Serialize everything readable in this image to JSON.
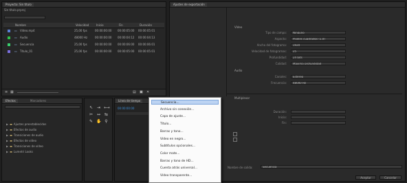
{
  "project": {
    "tab": "Proyecto: Sin título",
    "info_text": "Sin título.prproj",
    "columns": [
      "Nombre",
      "Velocidad",
      "Inicio",
      "Fin",
      "Duración"
    ],
    "items": [
      {
        "name": "Vídeo.mp4",
        "cells": [
          "25,00 fps",
          "00:00:00:00",
          "00:00:05:00",
          "00:00:05:01"
        ],
        "color": "#5a7fd6"
      },
      {
        "name": "Audio",
        "cells": [
          "48000 Hz",
          "00:00:00:00",
          "00:00:04:12",
          "00:00:04:13"
        ],
        "color": "#2fbf4a"
      },
      {
        "name": "Secuencia",
        "cells": [
          "25,00 fps",
          "00:00:00:00",
          "00:00:06:00",
          "00:00:06:01"
        ],
        "color": "#39d06e"
      },
      {
        "name": "Título_01",
        "cells": [
          "25,00 fps",
          "00:00:00:00",
          "00:00:05:00",
          "00:00:05:01"
        ],
        "color": "#7a70e0"
      }
    ]
  },
  "settings": {
    "tab": "Ajustes de exportación",
    "sections": [
      "Vídeo",
      "Audio",
      "Multiplexor"
    ],
    "video_fields": [
      {
        "label": "Tipo de campo:",
        "value": "Ninguno"
      },
      {
        "label": "Aspecto:",
        "value": "Píxeles cuadrados (1,0)"
      },
      {
        "label": "Ancho del fotograma:",
        "value": "1920"
      },
      {
        "label": "Velocidad de fotogramas:",
        "value": "25"
      },
      {
        "label": "Profundidad:",
        "value": "24 bits"
      },
      {
        "label": "Calidad:",
        "value": "Máxima profundidad"
      }
    ],
    "audio_fields": [
      {
        "label": "Canales:",
        "value": "Estéreo"
      },
      {
        "label": "Frecuencia:",
        "value": "48000 Hz"
      }
    ],
    "mux_fields": [
      {
        "label": "Duración:",
        "value": ""
      },
      {
        "label": "Inicio:",
        "value": ""
      },
      {
        "label": "Fin:",
        "value": ""
      }
    ],
    "name_label": "Nombre de salida:",
    "name_value": "Secuencia",
    "ok": "Aceptar",
    "cancel": "Cancelar"
  },
  "effects": {
    "tab": "Efectos",
    "tab2": "Marcadores",
    "search_placeholder": "",
    "tree": [
      "Ajustes preestablecidos",
      "Efectos de audio",
      "Transiciones de audio",
      "Efectos de vídeo",
      "Transiciones de vídeo",
      "Lumetri Looks"
    ]
  },
  "timeline": {
    "tab": "Línea de tiempo",
    "timecode": "00:00:00:00"
  },
  "context_menu": {
    "items": [
      "Secuencia...",
      "Archivo sin conexión...",
      "Capa de ajuste...",
      "Título...",
      "Barras y tono...",
      "Vídeo en negro...",
      "Subtítulos opcionales...",
      "Color mate...",
      "Barras y tono de HD...",
      "Cuenta atrás universal...",
      "Vídeo transparente..."
    ],
    "selected_index": 0
  },
  "colors": {
    "menu_highlight": "#bcd3f2",
    "panel_bg": "#262626",
    "app_bg": "#1f1f1f"
  }
}
